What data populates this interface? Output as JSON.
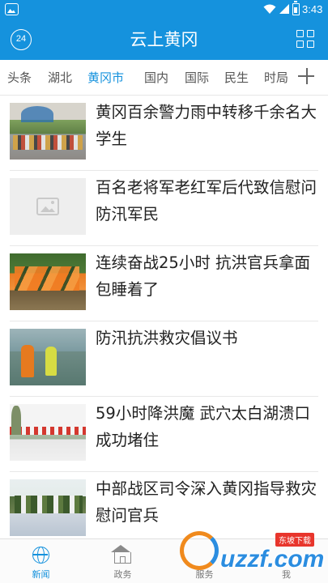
{
  "status_bar": {
    "time": "3:43"
  },
  "header": {
    "logo_text": "24",
    "title": "云上黄冈"
  },
  "tabs": [
    {
      "label": "头条",
      "active": false
    },
    {
      "label": "湖北",
      "active": false
    },
    {
      "label": "黄冈市",
      "active": true
    },
    {
      "label": "国内",
      "active": false
    },
    {
      "label": "国际",
      "active": false
    },
    {
      "label": "民生",
      "active": false
    },
    {
      "label": "时局",
      "active": false
    }
  ],
  "news": [
    {
      "headline": "黄冈百余警力雨中转移千余名大学生",
      "thumb": "students-evacuation-photo"
    },
    {
      "headline": "百名老将军老红军后代致信慰问防汛军民",
      "thumb": "image-placeholder-icon"
    },
    {
      "headline": "连续奋战25小时 抗洪官兵拿面包睡着了",
      "thumb": "soldiers-resting-photo"
    },
    {
      "headline": "防汛抗洪救灾倡议书",
      "thumb": "flood-rescue-photo"
    },
    {
      "headline": "59小时降洪魔 武穴太白湖溃口成功堵住",
      "thumb": "levee-repair-photo"
    },
    {
      "headline": "中部战区司令深入黄冈指导救灾慰问官兵",
      "thumb": "commander-visit-photo"
    }
  ],
  "bottom_nav": [
    {
      "label": "新闻",
      "active": true,
      "icon": "globe-icon"
    },
    {
      "label": "政务",
      "active": false,
      "icon": "building-icon"
    },
    {
      "label": "服务",
      "active": false,
      "icon": "service-icon"
    },
    {
      "label": "我",
      "active": false,
      "icon": "profile-icon"
    }
  ],
  "watermark": {
    "brand": "uzzf.com",
    "tag": "东坡下载"
  },
  "colors": {
    "brand_blue": "#1592dd",
    "text": "#222222",
    "watermark_orange": "#f08a1d"
  }
}
